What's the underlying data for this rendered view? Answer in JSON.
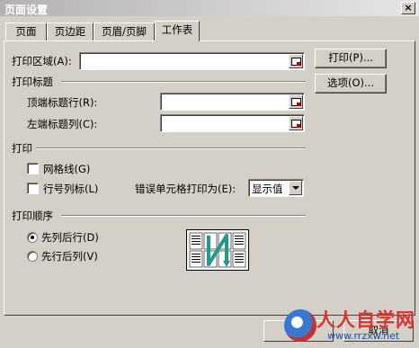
{
  "window": {
    "title": "页面设置",
    "close_glyph": "×"
  },
  "tabs": [
    {
      "label": "页面"
    },
    {
      "label": "页边距"
    },
    {
      "label": "页眉/页脚"
    },
    {
      "label": "工作表"
    }
  ],
  "print_area": {
    "label": "打印区域(A):",
    "value": ""
  },
  "print_titles": {
    "section_label": "打印标题",
    "top_rows_label": "顶端标题行(R):",
    "top_rows_value": "",
    "left_cols_label": "左端标题列(C):",
    "left_cols_value": ""
  },
  "print": {
    "section_label": "打印",
    "gridlines_label": "网格线(G)",
    "gridlines_checked": false,
    "row_col_headers_label": "行号列标(L)",
    "row_col_headers_checked": false,
    "cell_errors_label": "错误单元格打印为(E):",
    "cell_errors_value": "显示值"
  },
  "page_order": {
    "section_label": "打印顺序",
    "down_then_over_label": "先列后行(D)",
    "over_then_down_label": "先行后列(V)",
    "selected": "down_then_over"
  },
  "buttons": {
    "print": "打印(P)...",
    "options": "选项(O)...",
    "cancel": "取消"
  },
  "watermark": {
    "text": "人人自学网",
    "url": "www.rrzxw.net"
  },
  "colors": {
    "dialog_bg": "#d4d0c8",
    "preview_arrow": "#1f9a8a",
    "watermark_red": "#e03030"
  }
}
